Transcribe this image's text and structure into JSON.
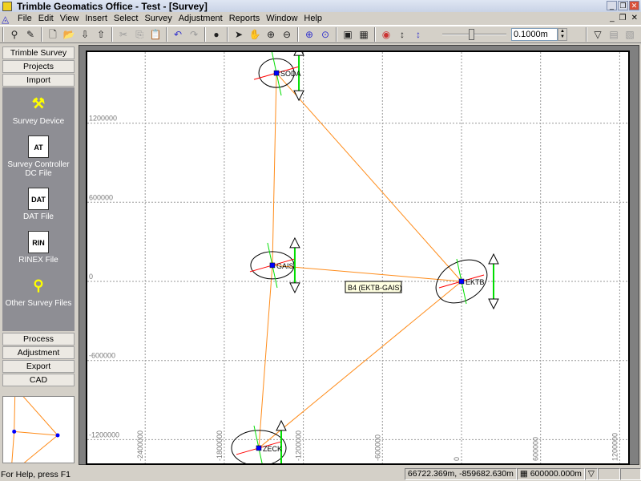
{
  "window": {
    "title": "Trimble Geomatics Office - Test - [Survey]"
  },
  "menu": [
    "File",
    "Edit",
    "View",
    "Insert",
    "Select",
    "Survey",
    "Adjustment",
    "Reports",
    "Window",
    "Help"
  ],
  "toolbar": {
    "tolerance_value": "0.1000m",
    "slider_level_fraction": 0.45
  },
  "sidebar": {
    "headers_top": [
      "Trimble Survey",
      "Projects",
      "Import"
    ],
    "items": [
      {
        "label": "Survey Device",
        "icon": "survey-device-icon"
      },
      {
        "label": "Survey Controller DC File",
        "icon": "dc-file-icon",
        "glyph": "AT"
      },
      {
        "label": "DAT File",
        "icon": "dat-file-icon",
        "glyph": "DAT"
      },
      {
        "label": "RINEX File",
        "icon": "rinex-file-icon",
        "glyph": "RIN"
      },
      {
        "label": "Other Survey Files",
        "icon": "other-survey-files-icon"
      }
    ],
    "headers_bottom": [
      "Process",
      "Adjustment",
      "Export",
      "CAD"
    ]
  },
  "chart_data": {
    "type": "network-plot",
    "x_ticks": [
      -2400000,
      -1800000,
      -1200000,
      -600000,
      0,
      600000,
      1200000
    ],
    "y_ticks": [
      1200000,
      600000,
      0,
      -600000,
      -1200000
    ],
    "x_tick_labels": [
      "-2400000",
      "-1800000",
      "-1200000",
      "-600000",
      "0",
      "600000",
      "1200000"
    ],
    "y_tick_labels": [
      "1200000",
      "600000",
      "0",
      "-600000",
      "-1200000"
    ],
    "grid": true,
    "points": [
      {
        "name": "SODA",
        "label": "SODA",
        "x": -1404000,
        "y": 1580000
      },
      {
        "name": "GAIS",
        "label": "GAIS",
        "x": -1435000,
        "y": 122000
      },
      {
        "name": "EKTB",
        "label": "EKTB",
        "x": 0,
        "y": 0
      },
      {
        "name": "ZECK",
        "label": "ZECK",
        "x": -1538000,
        "y": -1264000
      }
    ],
    "baselines": [
      [
        "SODA",
        "GAIS"
      ],
      [
        "SODA",
        "EKTB"
      ],
      [
        "GAIS",
        "EKTB"
      ],
      [
        "GAIS",
        "ZECK"
      ],
      [
        "ZECK",
        "EKTB"
      ]
    ],
    "tooltip": "B4 (EKTB-GAIS)",
    "colors": {
      "baseline": "#ff8c1a",
      "point": "#0000ff",
      "ellipse": "#000000",
      "axis_red": "#ff0000",
      "axis_green": "#00dd00"
    }
  },
  "status": {
    "help": "For Help, press F1",
    "coords": "66722.369m, -859682.630m",
    "scale": "600000.000m"
  }
}
